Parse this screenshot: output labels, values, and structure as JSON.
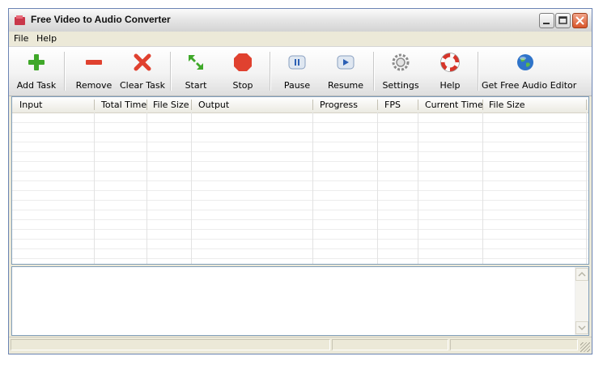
{
  "window": {
    "title": "Free Video to Audio Converter"
  },
  "menu": [
    "File",
    "Help"
  ],
  "toolbar": {
    "add_task": "Add Task",
    "remove": "Remove",
    "clear_task": "Clear Task",
    "start": "Start",
    "stop": "Stop",
    "pause": "Pause",
    "resume": "Resume",
    "settings": "Settings",
    "help": "Help",
    "get_editor": "Get Free Audio Editor"
  },
  "table": {
    "columns": [
      "Input",
      "Total Time",
      "File Size",
      "Output",
      "Progress",
      "FPS",
      "Current Time",
      "File Size"
    ],
    "rows": []
  },
  "log": {
    "text": ""
  },
  "status": {
    "panes": [
      "",
      "",
      ""
    ]
  },
  "colors": {
    "accent_green": "#3fa829",
    "remove_red": "#e0412f",
    "title_bar": "#e7e7e7"
  }
}
